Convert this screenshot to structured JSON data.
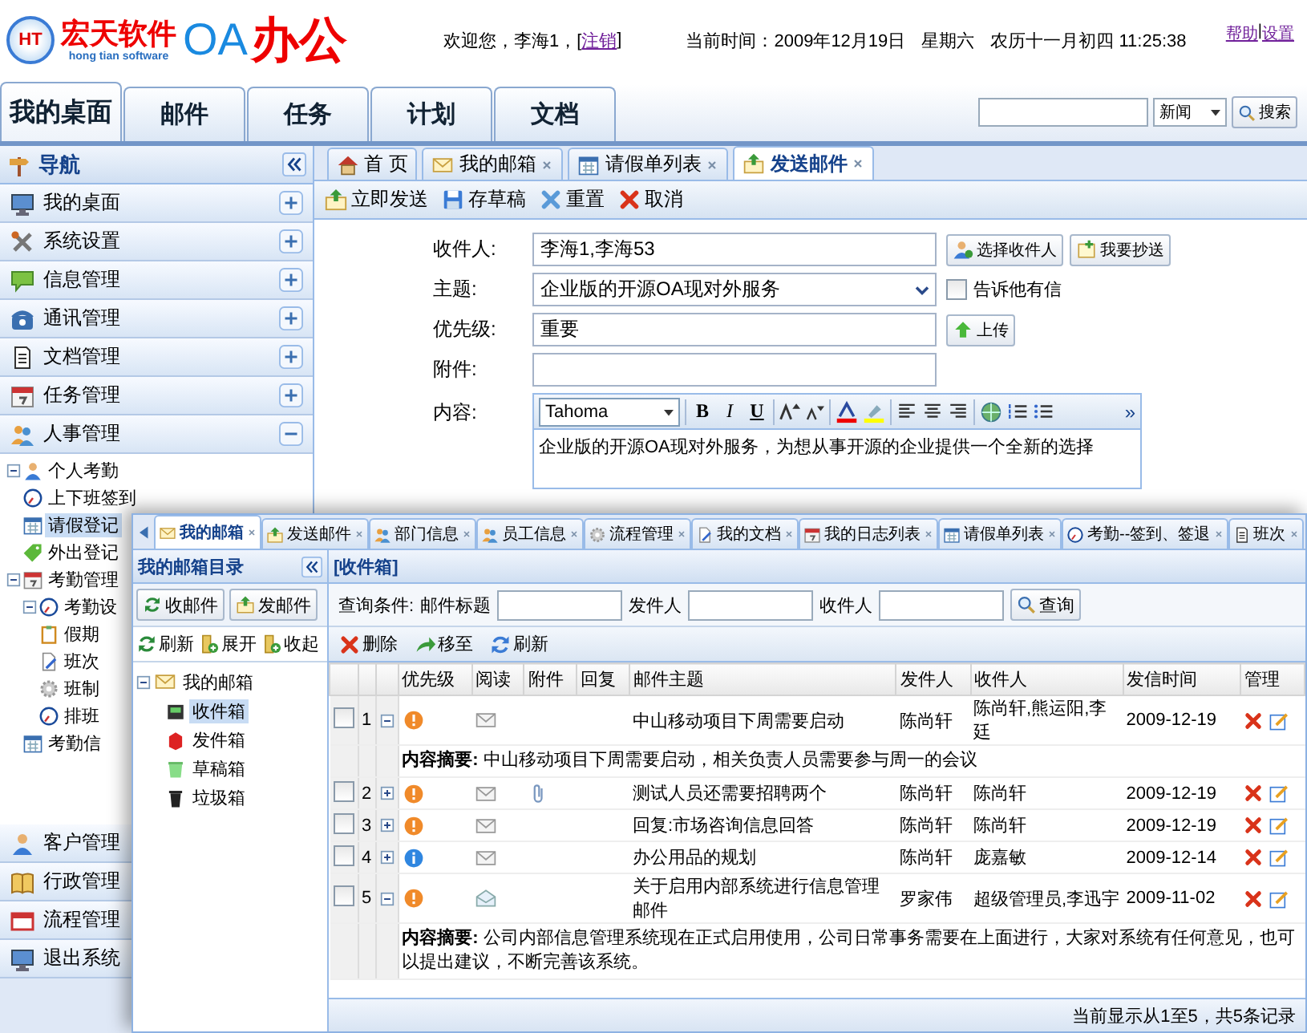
{
  "header": {
    "logo_mark": "HT",
    "brand": "宏天软件",
    "brand_en": "hong tian software",
    "product_prefix": "OA",
    "product": "办公",
    "welcome": "欢迎您，李海1，[",
    "logout": "注销",
    "welcome_end": "]",
    "datetime": "当前时间：2009年12月19日",
    "weekday": "星期六",
    "lunar": "农历十一月初四 11:25:38",
    "links": [
      "帮助",
      "设置"
    ],
    "link_separator": "|"
  },
  "nav_tabs": [
    {
      "label": "我的桌面",
      "selected": true
    },
    {
      "label": "邮件",
      "selected": false
    },
    {
      "label": "任务",
      "selected": false
    },
    {
      "label": "计划",
      "selected": false
    },
    {
      "label": "文档",
      "selected": false
    }
  ],
  "search": {
    "category": "新闻",
    "button": "搜索"
  },
  "sidebar": {
    "title": "导航",
    "sections": [
      {
        "label": "我的桌面",
        "expanded": false
      },
      {
        "label": "系统设置",
        "expanded": false
      },
      {
        "label": "信息管理",
        "expanded": false
      },
      {
        "label": "通讯管理",
        "expanded": false
      },
      {
        "label": "文档管理",
        "expanded": false
      },
      {
        "label": "任务管理",
        "expanded": false
      },
      {
        "label": "人事管理",
        "expanded": true
      }
    ],
    "tree": [
      {
        "label": "个人考勤",
        "selected": false,
        "expanded": true,
        "children": [
          {
            "label": "上下班签到",
            "selected": false
          },
          {
            "label": "请假登记",
            "selected": true
          },
          {
            "label": "外出登记",
            "selected": false
          }
        ]
      },
      {
        "label": "考勤管理",
        "selected": false,
        "expanded": true,
        "children": [
          {
            "label": "考勤设",
            "selected": false,
            "expanded": true,
            "children": [
              {
                "label": "假期",
                "selected": false
              },
              {
                "label": "班次",
                "selected": false
              },
              {
                "label": "班制",
                "selected": false
              },
              {
                "label": "排班",
                "selected": false
              }
            ]
          },
          {
            "label": "考勤信",
            "selected": false
          }
        ]
      }
    ],
    "bottom_sections": [
      {
        "label": "客户管理"
      },
      {
        "label": "行政管理"
      },
      {
        "label": "流程管理"
      },
      {
        "label": "退出系统"
      }
    ]
  },
  "content_tabs": [
    {
      "label": "首 页",
      "selected": false,
      "closable": false
    },
    {
      "label": "我的邮箱",
      "selected": false,
      "closable": true
    },
    {
      "label": "请假单列表",
      "selected": false,
      "closable": true
    },
    {
      "label": "发送邮件",
      "selected": true,
      "closable": true
    }
  ],
  "toolbar": [
    "立即发送",
    "存草稿",
    "重置",
    "取消"
  ],
  "compose": {
    "recipients": {
      "label": "收件人:",
      "value": "李海1,李海53"
    },
    "recipient_buttons": [
      "选择收件人",
      "我要抄送"
    ],
    "subject": {
      "label": "主题:",
      "value": "企业版的开源OA现对外服务"
    },
    "notify": {
      "label": "告诉他有信",
      "checked": false
    },
    "priority": {
      "label": "优先级:",
      "value": "重要"
    },
    "upload": "上传",
    "attachment": {
      "label": "附件:"
    },
    "content": {
      "label": "内容:",
      "font": "Tahoma",
      "format_buttons": [
        "B",
        "I",
        "U"
      ],
      "more": "»",
      "text": "企业版的开源OA现对外服务，为想从事开源的企业提供一个全新的选择"
    }
  },
  "mail_window": {
    "tabs": [
      {
        "label": "我的邮箱",
        "selected": true
      },
      {
        "label": "发送邮件",
        "selected": false
      },
      {
        "label": "部门信息",
        "selected": false
      },
      {
        "label": "员工信息",
        "selected": false
      },
      {
        "label": "流程管理",
        "selected": false
      },
      {
        "label": "我的文档",
        "selected": false
      },
      {
        "label": "我的日志列表",
        "selected": false
      },
      {
        "label": "请假单列表",
        "selected": false
      },
      {
        "label": "考勤--签到、签退",
        "selected": false
      },
      {
        "label": "班次",
        "selected": false
      }
    ],
    "directory": {
      "title": "我的邮箱目录",
      "buttons": [
        "收邮件",
        "发邮件"
      ],
      "actions": [
        "刷新",
        "展开",
        "收起"
      ],
      "tree": {
        "label": "我的邮箱",
        "expanded": true,
        "children": [
          {
            "label": "收件箱",
            "selected": true
          },
          {
            "label": "发件箱",
            "selected": false
          },
          {
            "label": "草稿箱",
            "selected": false
          },
          {
            "label": "垃圾箱",
            "selected": false
          }
        ]
      }
    },
    "inbox": {
      "title": "[收件箱]",
      "query_label": "查询条件:",
      "filters": [
        {
          "label": "邮件标题"
        },
        {
          "label": "发件人"
        },
        {
          "label": "收件人"
        }
      ],
      "query_button": "查询",
      "actions": [
        "删除",
        "移至",
        "刷新"
      ],
      "columns": [
        "优先级",
        "阅读",
        "附件",
        "回复",
        "邮件主题",
        "发件人",
        "收件人",
        "发信时间",
        "管理"
      ],
      "rows": [
        {
          "index": "1",
          "checked": false,
          "expanded": true,
          "important": true,
          "read": false,
          "attachment": false,
          "subject": "中山移动项目下周需要启动",
          "sender": "陈尚轩",
          "recipient": "陈尚轩,熊运阳,李廷",
          "date": "2009-12-19",
          "summary_label": "内容摘要:",
          "summary": "中山移动项目下周需要启动，相关负责人员需要参与周一的会议"
        },
        {
          "index": "2",
          "checked": false,
          "expanded": false,
          "important": true,
          "read": false,
          "attachment": true,
          "subject": "测试人员还需要招聘两个",
          "sender": "陈尚轩",
          "recipient": "陈尚轩",
          "date": "2009-12-19"
        },
        {
          "index": "3",
          "checked": false,
          "expanded": false,
          "important": true,
          "read": false,
          "attachment": false,
          "subject": "回复:市场咨询信息回答",
          "sender": "陈尚轩",
          "recipient": "陈尚轩",
          "date": "2009-12-19"
        },
        {
          "index": "4",
          "checked": false,
          "expanded": false,
          "important": false,
          "read": false,
          "attachment": false,
          "subject": "办公用品的规划",
          "sender": "陈尚轩",
          "recipient": "庞嘉敏",
          "date": "2009-12-14"
        },
        {
          "index": "5",
          "checked": false,
          "expanded": true,
          "important": true,
          "read": true,
          "attachment": false,
          "subject": "关于启用内部系统进行信息管理邮件",
          "sender": "罗家伟",
          "recipient": "超级管理员,李迅宇",
          "date": "2009-11-02",
          "summary_label": "内容摘要:",
          "summary": "公司内部信息管理系统现在正式启用使用，公司日常事务需要在上面进行，大家对系统有任何意见，也可以提出建议，不断完善该系统。"
        }
      ],
      "footer": "当前显示从1至5，共5条记录"
    }
  }
}
